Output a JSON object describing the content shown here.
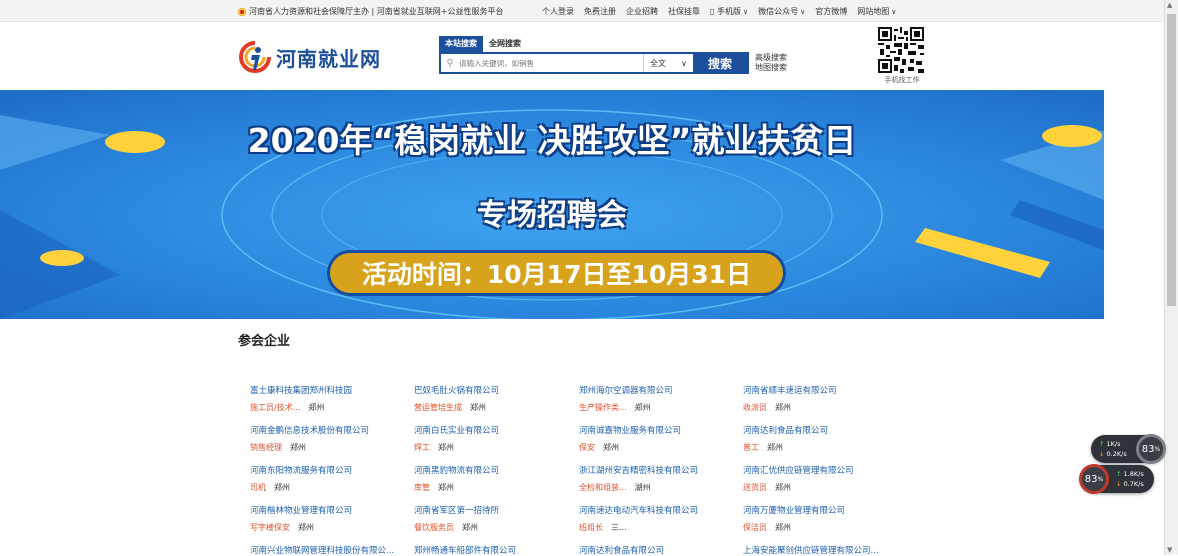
{
  "topbar": {
    "sponsor": "河南省人力资源和社会保障厅主办 | 河南省就业互联网+公益性服务平台",
    "links": [
      "个人登录",
      "免费注册",
      "企业招聘",
      "社保挂靠",
      "手机版",
      "微信公众号",
      "官方微博",
      "网站地图"
    ]
  },
  "header": {
    "logo_text": "河南就业网",
    "search_tabs": [
      "本站搜索",
      "全网搜索"
    ],
    "search_placeholder": "请输入关键词，如销售",
    "scope_select": "全文",
    "search_button": "搜索",
    "advanced_search": "高级搜索",
    "map_search": "地图搜索",
    "qr_caption": "手机找工作"
  },
  "banner": {
    "title": "2020年“稳岗就业 决胜攻坚”就业扶贫日",
    "subtitle": "专场招聘会",
    "period": "活动时间：10月17日至10月31日"
  },
  "companies_section": {
    "title": "参会企业",
    "companies": [
      {
        "name": "富士康科技集团郑州科技园",
        "position": "施工员/技术...",
        "city": "郑州"
      },
      {
        "name": "巴奴毛肚火锅有限公司",
        "position": "营运管培生成",
        "city": "郑州"
      },
      {
        "name": "郑州海尔空调器有限公司",
        "position": "生产操作类...",
        "city": "郑州"
      },
      {
        "name": "河南省顺丰速运有限公司",
        "position": "收派员",
        "city": "郑州"
      },
      {
        "name": "河南金鹏信息技术股份有限公司",
        "position": "销售经理",
        "city": "郑州"
      },
      {
        "name": "河南白氏实业有限公司",
        "position": "焊工",
        "city": "郑州"
      },
      {
        "name": "河南诚嘉物业服务有限公司",
        "position": "保安",
        "city": "郑州"
      },
      {
        "name": "河南达利食品有限公司",
        "position": "普工",
        "city": "郑州"
      },
      {
        "name": "河南东阳物流服务有限公司",
        "position": "司机",
        "city": "郑州"
      },
      {
        "name": "河南黑豹物流有限公司",
        "position": "库管",
        "city": "郑州"
      },
      {
        "name": "浙江湖州安吉精密科技有限公司",
        "position": "全检和组装...",
        "city": "湖州"
      },
      {
        "name": "河南汇优供应链管理有限公司",
        "position": "送货员",
        "city": "郑州"
      },
      {
        "name": "河南楷林物业管理有限公司",
        "position": "写字楼保安",
        "city": "郑州"
      },
      {
        "name": "河南省军区第一招待所",
        "position": "餐饮服务员",
        "city": "郑州"
      },
      {
        "name": "河南速达电动汽车科技有限公司",
        "position": "班组长",
        "city": "三..."
      },
      {
        "name": "河南万厦物业管理有限公司",
        "position": "保洁员",
        "city": "郑州"
      },
      {
        "name": "河南兴业物联网管理科技股份有限公...",
        "position": "",
        "city": ""
      },
      {
        "name": "郑州畅通车船部件有限公司",
        "position": "",
        "city": ""
      },
      {
        "name": "河南达利食品有限公司",
        "position": "",
        "city": ""
      },
      {
        "name": "上海安能聚创供应链管理有限公司...",
        "position": "",
        "city": ""
      }
    ]
  },
  "widgets": {
    "w1_up": "1K/s",
    "w1_down": "0.2K/s",
    "w1_gauge": "83",
    "w2_up": "1.8K/s",
    "w2_down": "0.7K/s",
    "w2_gauge": "83",
    "gauge_unit": "%"
  },
  "colors": {
    "brand_blue": "#1c4f9c",
    "link_blue": "#1c5fb0",
    "job_orange": "#e0502b",
    "banner_gold": "#d7a21c"
  }
}
